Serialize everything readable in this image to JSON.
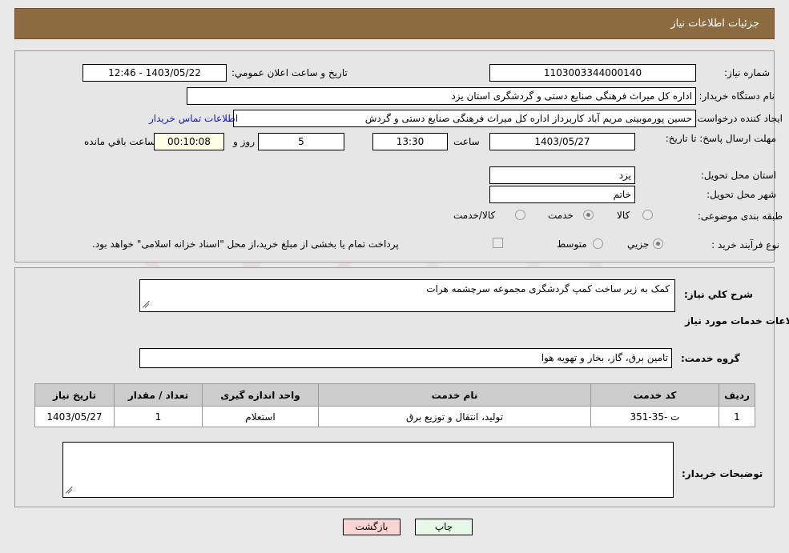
{
  "header": {
    "title": "جزئیات اطلاعات نیاز",
    "bg_color": "#8c6b41",
    "text_color": "#ffffff"
  },
  "watermark": {
    "text": "AriaTender.net"
  },
  "top_panel": {
    "need_number_label": "شماره نیاز:",
    "need_number_value": "1103003344000140",
    "public_announce_label": "تاریخ و ساعت اعلان عمومي:",
    "public_announce_value": "1403/05/22 - 12:46",
    "buyer_org_label": "نام دستگاه خریدار:",
    "buyer_org_value": "اداره کل میراث فرهنگی  صنایع دستی و گردشگری استان یزد",
    "requester_label": "ایجاد کننده درخواست:",
    "requester_value": "حسین پورموبینی مریم آباد کاربرداز اداره کل میراث فرهنگی  صنایع دستی و گردش",
    "contact_link": "اطلاعات تماس خریدار",
    "deadline_label": "مهلت ارسال پاسخ: تا تاریخ:",
    "deadline_date": "1403/05/27",
    "deadline_time_label": "ساعت",
    "deadline_time": "13:30",
    "days_value": "5",
    "days_label": "روز و",
    "countdown_value": "00:10:08",
    "countdown_label": "ساعت باقي مانده",
    "province_label": "استان محل تحویل:",
    "province_value": "یزد",
    "city_label": "شهر محل تحویل:",
    "city_value": "خاتم",
    "classification_label": "طبقه بندی موضوعی:",
    "classification_options": [
      {
        "label": "کالا",
        "selected": false
      },
      {
        "label": "خدمت",
        "selected": true
      },
      {
        "label": "کالا/خدمت",
        "selected": false
      }
    ],
    "purchase_type_label": "نوع فرآیند خرید :",
    "purchase_type_options": [
      {
        "label": "جزیي",
        "selected": true
      },
      {
        "label": "متوسط",
        "selected": false
      }
    ],
    "treasury_checkbox_checked": false,
    "treasury_note": "پرداخت تمام یا بخشی از مبلغ خرید،از محل \"اسناد خزانه اسلامی\" خواهد بود."
  },
  "bottom_panel": {
    "general_desc_label": "شرح کلي نیاز:",
    "general_desc_value": "کمک به زیر ساخت کمپ گردشگری مجموعه سرچشمه هرات",
    "services_info_heading": "اطلاعات خدمات مورد نیاز",
    "service_group_label": "گروه خدمت:",
    "service_group_value": "تامین برق، گاز، بخار و تهویه هوا",
    "buyer_notes_label": "توضیحات خریدار:",
    "buyer_notes_value": ""
  },
  "services_table": {
    "columns": [
      "ردیف",
      "کد خدمت",
      "نام خدمت",
      "واحد اندازه گیری",
      "تعداد / مقدار",
      "تاریخ نیاز"
    ],
    "rows": [
      {
        "row_no": "1",
        "service_code": "ت -35-351",
        "service_name": "تولید، انتقال و توزیع برق",
        "unit": "استعلام",
        "quantity": "1",
        "need_date": "1403/05/27"
      }
    ]
  },
  "footer": {
    "print_label": "چاپ",
    "back_label": "بازگشت"
  }
}
